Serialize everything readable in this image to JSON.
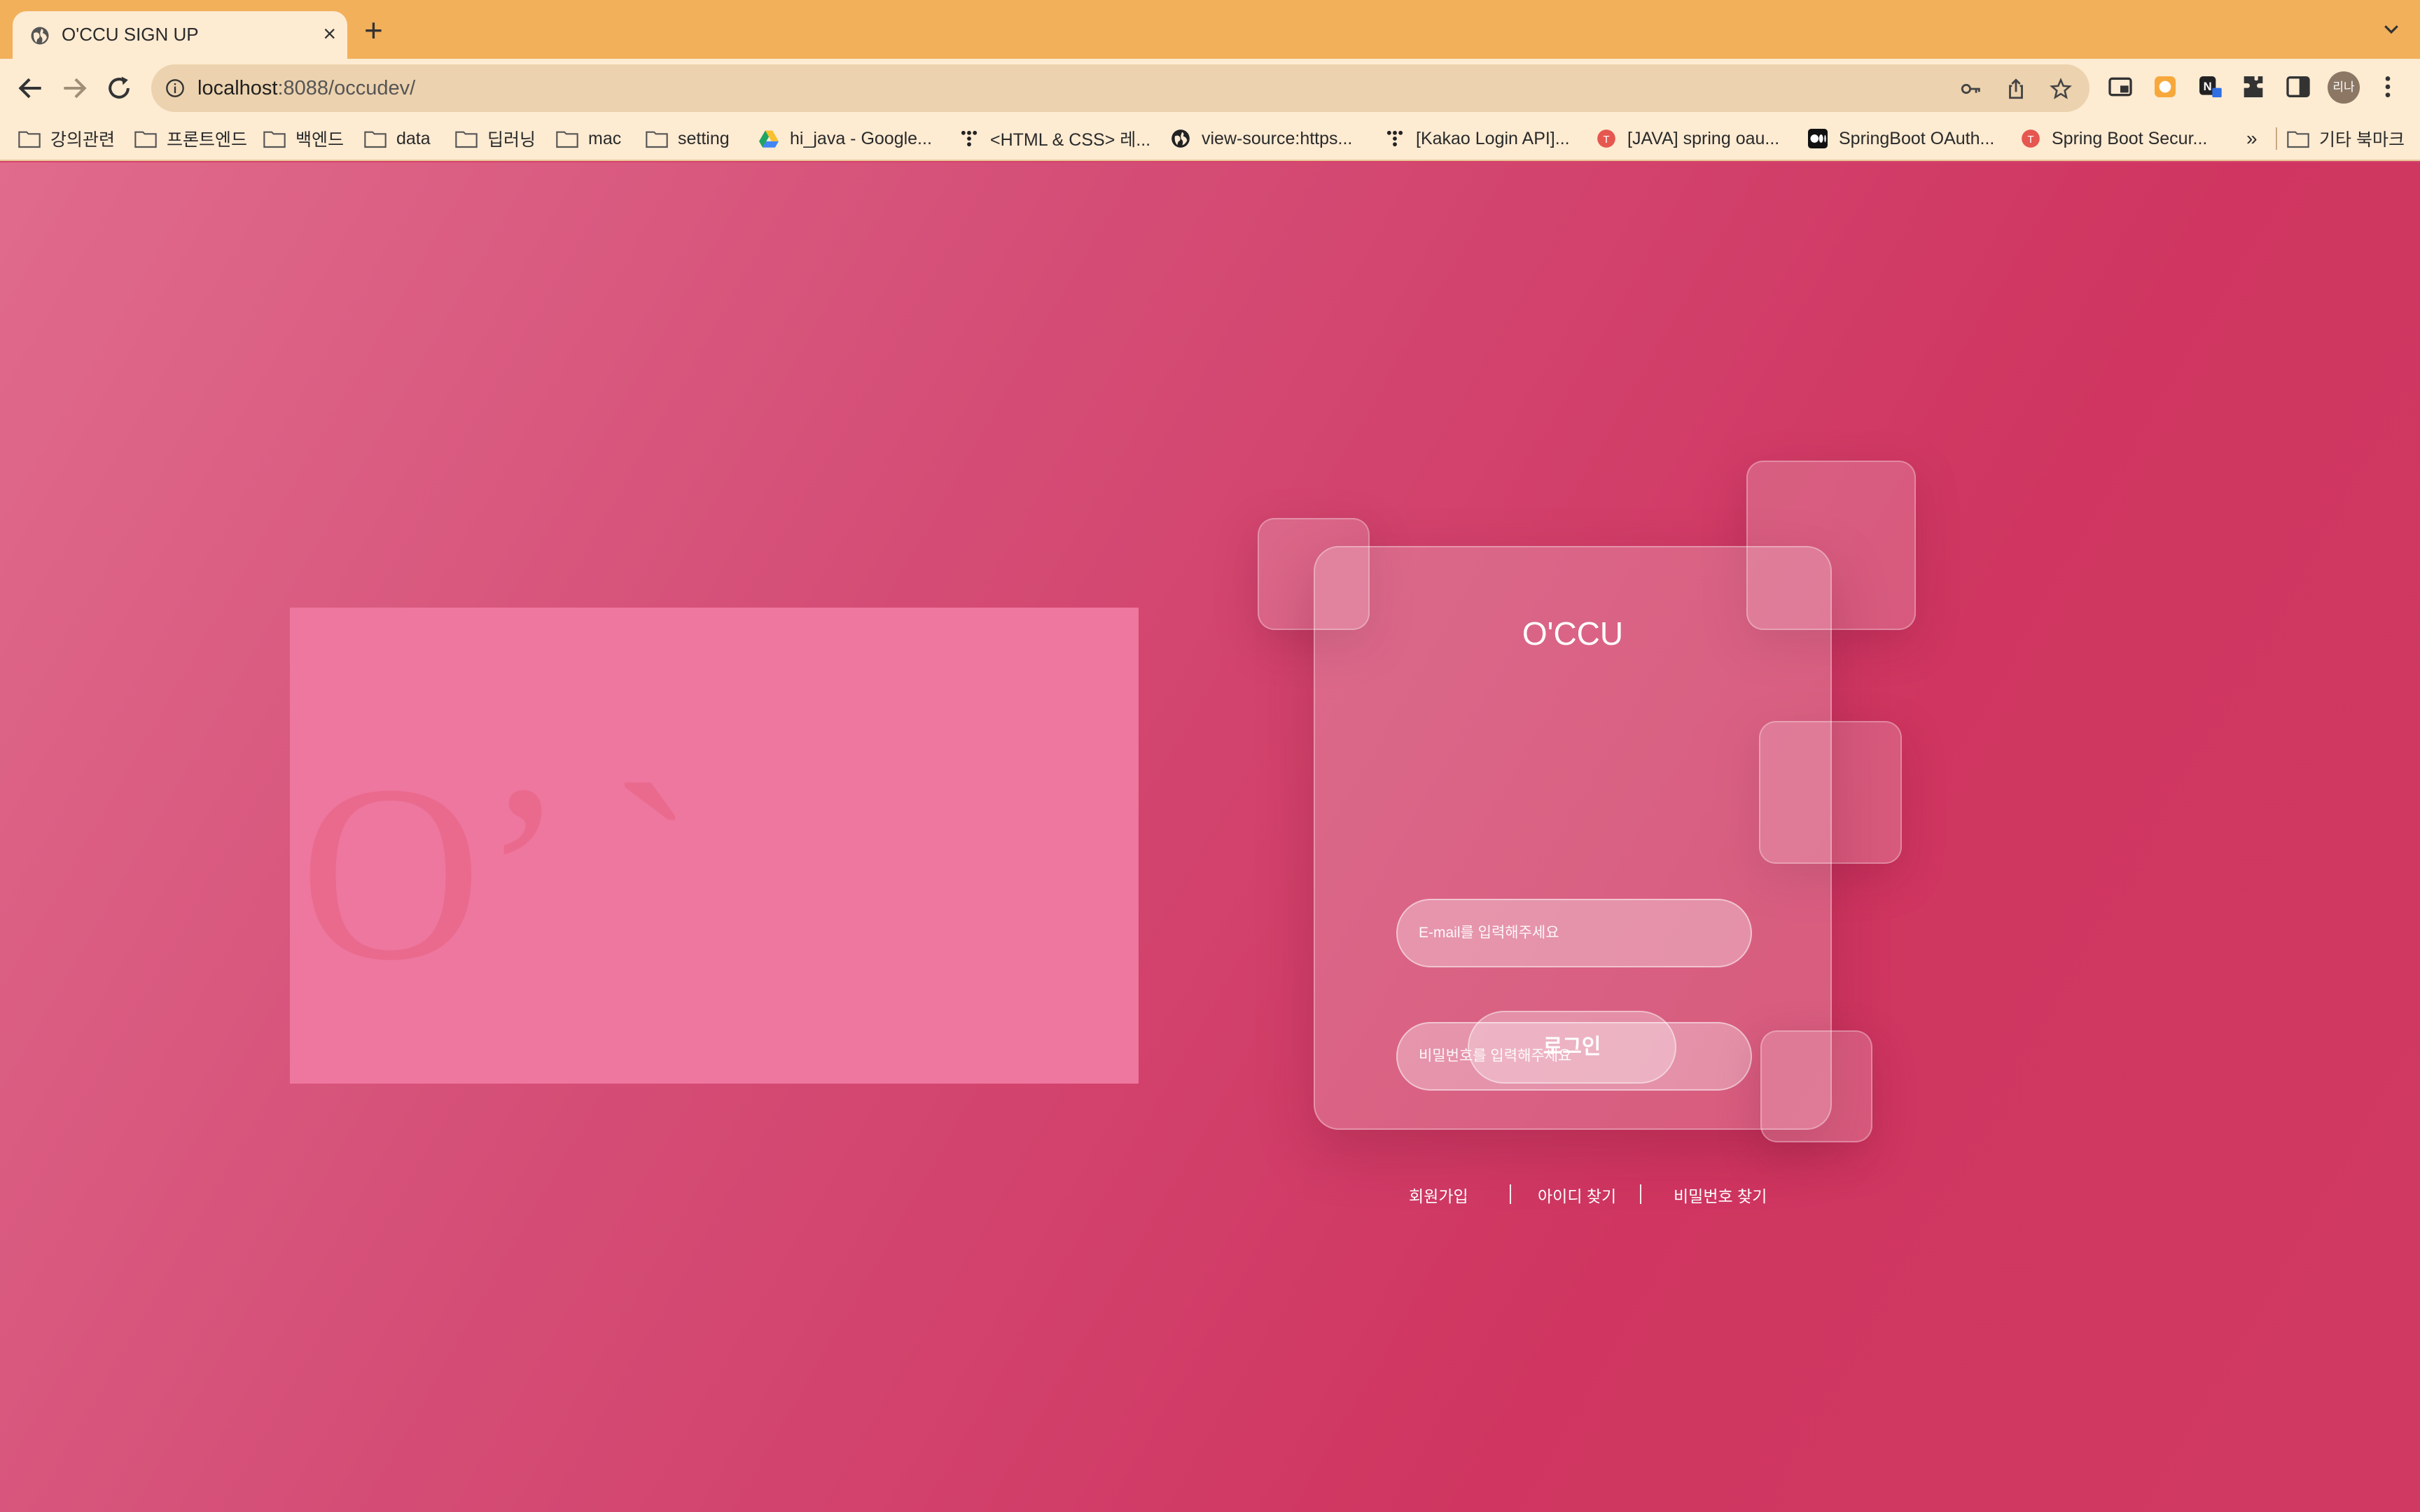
{
  "browser": {
    "tab_title": "O'CCU SIGN UP",
    "tab_close": "×",
    "new_tab": "+",
    "url_host": "localhost",
    "url_path": ":8088/occudev/",
    "profile_initials": "리나",
    "bookmarks": [
      {
        "label": "강의관련",
        "icon": "folder-icon"
      },
      {
        "label": "프론트엔드",
        "icon": "folder-icon"
      },
      {
        "label": "백엔드",
        "icon": "folder-icon"
      },
      {
        "label": "data",
        "icon": "folder-icon"
      },
      {
        "label": "딥러닝",
        "icon": "folder-icon"
      },
      {
        "label": "mac",
        "icon": "folder-icon"
      },
      {
        "label": "setting",
        "icon": "folder-icon"
      },
      {
        "label": "hi_java - Google...",
        "icon": "google-drive-icon"
      },
      {
        "label": "<HTML & CSS> 레...",
        "icon": "tistory-icon"
      },
      {
        "label": "view-source:https...",
        "icon": "globe-icon"
      },
      {
        "label": "[Kakao Login API]...",
        "icon": "tistory-icon"
      },
      {
        "label": "[JAVA] spring oau...",
        "icon": "velog-icon"
      },
      {
        "label": "SpringBoot OAuth...",
        "icon": "medium-icon"
      },
      {
        "label": "Spring Boot Secur...",
        "icon": "velog-icon"
      }
    ],
    "overflow": "»",
    "other_bookmarks": "기타 북마크"
  },
  "page": {
    "promo_text": "O’ `",
    "card_title": "O'CCU",
    "email_placeholder": "E-mail를 입력해주세요",
    "password_placeholder": "비밀번호를 입력해주세요",
    "login_label": "로그인",
    "links": {
      "signup": "회원가입",
      "find_id": "아이디 찾기",
      "find_password": "비밀번호 찾기"
    }
  },
  "colors": {
    "tabstrip": "#f2b05a",
    "toolbar": "#fdebd2",
    "page_bg": "#d4436a",
    "promo_box": "#ee779f"
  }
}
